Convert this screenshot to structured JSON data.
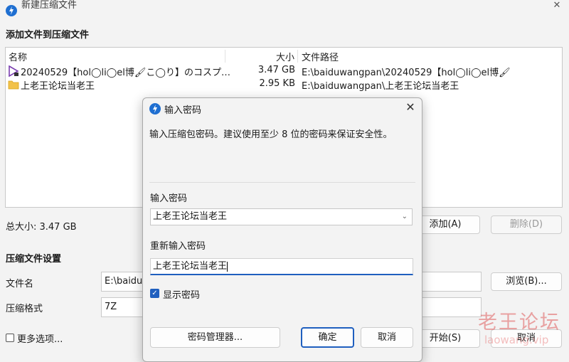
{
  "window": {
    "title": "新建压缩文件",
    "close_glyph": "✕"
  },
  "add_section": {
    "heading": "添加文件到压缩文件"
  },
  "file_list": {
    "columns": {
      "name": "名称",
      "size": "大小",
      "path": "文件路径"
    },
    "rows": [
      {
        "icon": "video-file-icon",
        "name": "20240529【hol◯li◯el博🖌こ◯り】のコスプ…",
        "size": "3.47 GB",
        "path": "E:\\baiduwangpan\\20240529【hol◯li◯el博🖌"
      },
      {
        "icon": "folder-icon",
        "name": "上老王论坛当老王",
        "size": "2.95 KB",
        "path": "E:\\baiduwangpan\\上老王论坛当老王"
      }
    ]
  },
  "total_size": "总大小: 3.47 GB",
  "buttons": {
    "add": "添加(A)",
    "delete": "删除(D)",
    "browse": "浏览(B)...",
    "start": "开始(S)",
    "cancel": "取消"
  },
  "settings": {
    "heading": "压缩文件设置",
    "filename_label": "文件名",
    "filename_value": "E:\\baiduw",
    "format_label": "压缩格式",
    "format_value": "7Z",
    "more_options": "更多选项..."
  },
  "dialog": {
    "title": "输入密码",
    "close_glyph": "✕",
    "description": "输入压缩包密码。建议使用至少 8 位的密码来保证安全性。",
    "password_label": "输入密码",
    "password_value": "上老王论坛当老王",
    "repeat_label": "重新输入密码",
    "repeat_value": "上老王论坛当老王",
    "show_password": "显示密码",
    "show_password_checked": true,
    "manager_button": "密码管理器...",
    "ok_button": "确定",
    "cancel_button": "取消"
  },
  "watermark": {
    "text": "老王论坛",
    "url": "laowang.vip"
  },
  "colors": {
    "accent": "#1f5fbf",
    "app_icon": "#1f6fd1"
  }
}
